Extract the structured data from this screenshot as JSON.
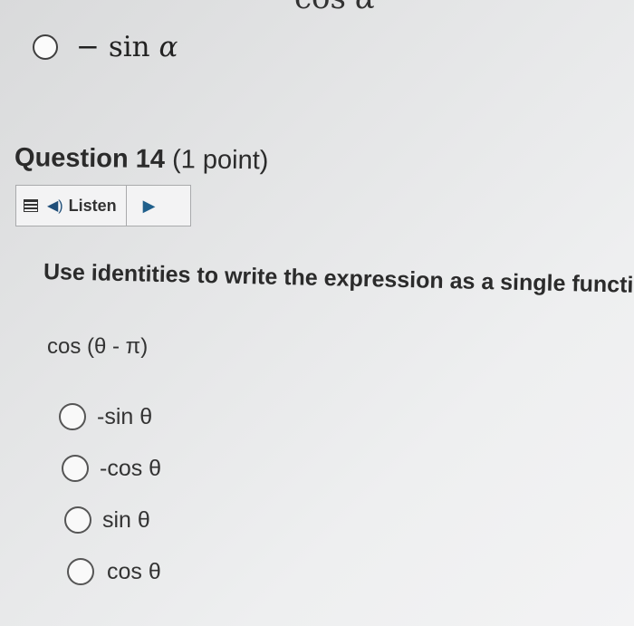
{
  "previous_question": {
    "top_text_func": "cos",
    "top_text_var": "α",
    "option_label_func": "− sin",
    "option_label_var": "α"
  },
  "question": {
    "title": "Question 14",
    "points": "(1 point)",
    "listen_label": "Listen",
    "prompt": "Use identities to write the expression as a single function of x",
    "expression": "cos (θ - π)",
    "options": [
      {
        "label": "-sin θ"
      },
      {
        "label": "-cos θ"
      },
      {
        "label": "sin θ"
      },
      {
        "label": "cos θ"
      }
    ]
  },
  "icons": {
    "menu": "menu-icon",
    "speaker": "speaker-icon",
    "play": "play-icon"
  },
  "colors": {
    "accent_blue": "#1f5f8b",
    "text": "#2e2e2e"
  }
}
